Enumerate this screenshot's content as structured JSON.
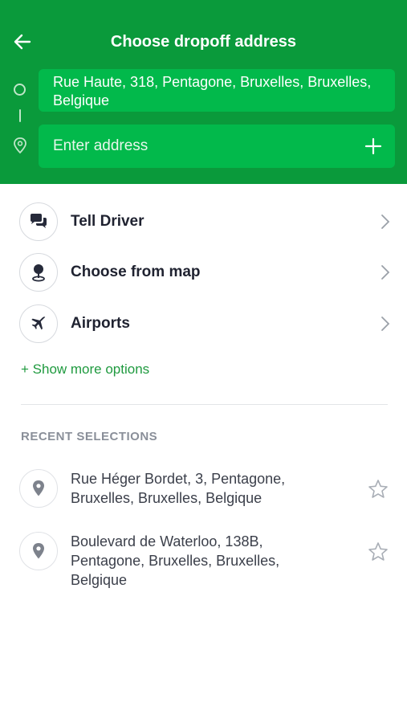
{
  "header": {
    "title": "Choose dropoff address",
    "origin_address": "Rue Haute, 318, Pentagone, Bruxelles, Bruxelles, Belgique",
    "destination_placeholder": "Enter address",
    "brand_color": "#0a9a3b",
    "field_color": "#02b94b"
  },
  "options": [
    {
      "label": "Tell Driver",
      "icon": "chat-bubbles-icon"
    },
    {
      "label": "Choose from map",
      "icon": "map-pin-icon"
    },
    {
      "label": "Airports",
      "icon": "airplane-icon"
    }
  ],
  "show_more_label": "+ Show more options",
  "recent": {
    "title": "RECENT SELECTIONS",
    "items": [
      {
        "address": "Rue Héger Bordet, 3, Pentagone, Bruxelles, Bruxelles, Belgique",
        "icon": "location-pin-icon",
        "favorite": false
      },
      {
        "address": "Boulevard de Waterloo, 138B, Pentagone, Bruxelles, Bruxelles, Belgique",
        "icon": "location-pin-icon",
        "favorite": false
      }
    ]
  }
}
